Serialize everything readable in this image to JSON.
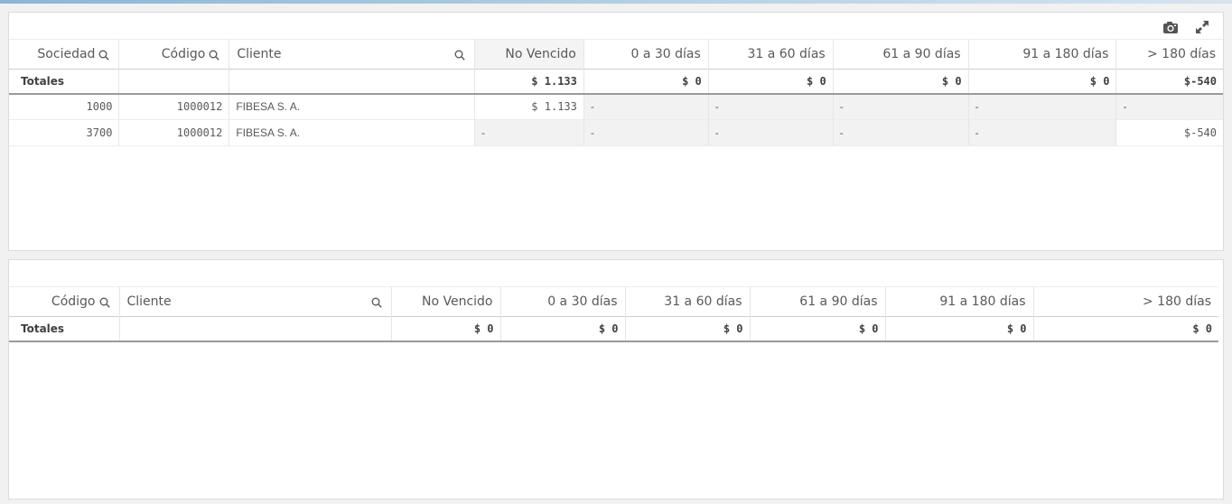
{
  "table1": {
    "headers": [
      "Sociedad",
      "Código",
      "Cliente",
      "No Vencido",
      "0 a 30 días",
      "31 a 60 días",
      "61 a 90 días",
      "91 a 180 días",
      "> 180 días"
    ],
    "totals": [
      "Totales",
      "",
      "",
      "$ 1.133",
      "$ 0",
      "$ 0",
      "$ 0",
      "$ 0",
      "$-540"
    ],
    "rows": [
      [
        "1000",
        "1000012",
        "FIBESA S. A.",
        "$ 1.133",
        "-",
        "-",
        "-",
        "-",
        "-"
      ],
      [
        "3700",
        "1000012",
        "FIBESA S. A.",
        "-",
        "-",
        "-",
        "-",
        "-",
        "$-540"
      ]
    ]
  },
  "table2": {
    "headers": [
      "Código",
      "Cliente",
      "No Vencido",
      "0 a 30 días",
      "31 a 60 días",
      "61 a 90 días",
      "91 a 180 días",
      "> 180 días"
    ],
    "totals": [
      "Totales",
      "",
      "$ 0",
      "$ 0",
      "$ 0",
      "$ 0",
      "$ 0",
      "$ 0"
    ]
  },
  "icons": {
    "snapshot": "camera-icon",
    "expand": "expand-icon",
    "search": "search-icon",
    "sort": "sort-descending-icon"
  }
}
